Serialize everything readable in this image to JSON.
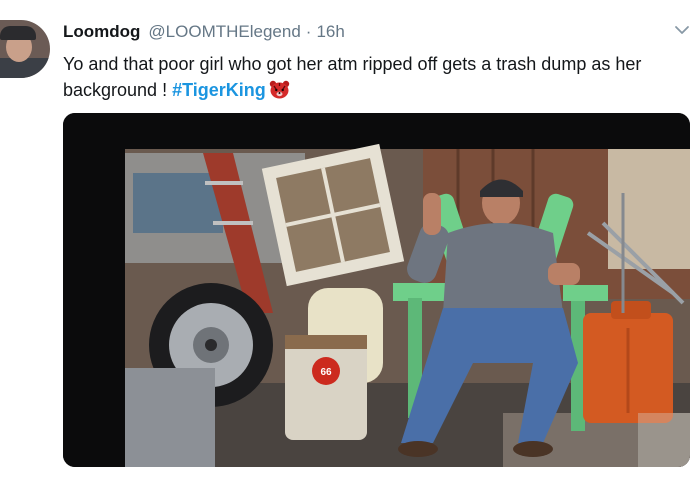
{
  "tweet": {
    "display_name": "Loomdog",
    "handle": "@LOOMTHElegend",
    "separator": "·",
    "time": "16h",
    "text_main": "Yo and that poor girl who got her atm ripped off gets a trash dump as her background ! ",
    "hashtag": "#TigerKing",
    "emoji": "tiger-face-emoji",
    "menu_icon": "chevron-down-icon"
  },
  "media": {
    "description_icon": "photo",
    "sign_text": "66"
  }
}
